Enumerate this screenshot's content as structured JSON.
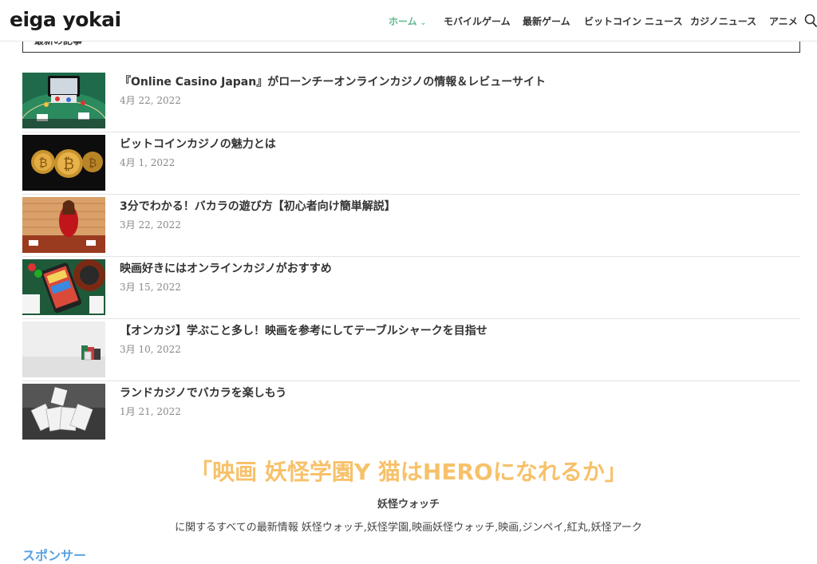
{
  "header": {
    "logo": "eiga yokai",
    "nav": [
      {
        "label": "ホーム"
      },
      {
        "label": "モバイルゲーム"
      },
      {
        "label": "最新ゲーム"
      },
      {
        "label": "ビットコイン ニュース"
      },
      {
        "label": "カジノニュース"
      },
      {
        "label": "アニメ"
      }
    ],
    "search_icon": "search-icon"
  },
  "section": {
    "title": "最新の記事"
  },
  "posts": [
    {
      "title": "『Online Casino Japan』がローンチーオンラインカジノの情報＆レビューサイト",
      "date": "4月 22, 2022"
    },
    {
      "title": "ビットコインカジノの魅力とは",
      "date": "4月 1, 2022"
    },
    {
      "title": "3分でわかる！バカラの遊び方【初心者向け簡単解説】",
      "date": "3月 22, 2022"
    },
    {
      "title": "映画好きにはオンラインカジノがおすすめ",
      "date": "3月 15, 2022"
    },
    {
      "title": "【オンカジ】学ぶこと多し！映画を参考にしてテーブルシャークを目指せ",
      "date": "3月 10, 2022"
    },
    {
      "title": "ランドカジノでバカラを楽しもう",
      "date": "1月 21, 2022"
    }
  ],
  "promo": {
    "title": "「映画 妖怪学園Y 猫はHEROになれるか」",
    "subtitle": "妖怪ウォッチ",
    "description": "に関するすべての最新情報 妖怪ウォッチ,妖怪学園,映画妖怪ウォッチ,映画,ジンペイ,紅丸,妖怪アーク"
  },
  "sponsor": {
    "label": "スポンサー"
  },
  "colors": {
    "accent": "#5fb98c",
    "promo": "#f7c16a",
    "sponsor": "#5aa0e0"
  }
}
